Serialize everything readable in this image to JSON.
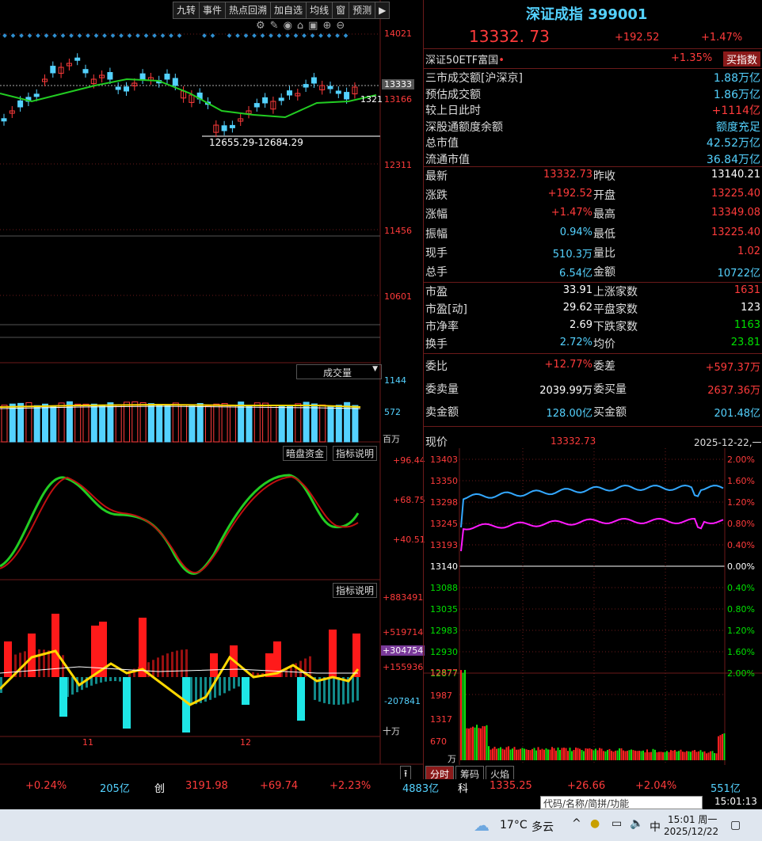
{
  "toolbar": {
    "items": [
      "九转",
      "事件",
      "热点回溯",
      "加自选",
      "均线",
      "窗",
      "预测"
    ]
  },
  "kline": {
    "yaxis": [
      "14021",
      "13333",
      "13166",
      "12311",
      "11456",
      "10601"
    ],
    "ma_value": "1321",
    "low_range": "12655.29-12684.29",
    "vol_label": "成交量",
    "vol_axis": [
      "1144",
      "572",
      "百万"
    ],
    "btn_dark": "暗盘资金",
    "btn_ind": "指标说明",
    "ind1_axis": [
      "+96.44",
      "+68.75",
      "+40.51"
    ],
    "btn_ind2": "指标说明",
    "ind2_axis": [
      "+883491",
      "+519714",
      "+304754",
      "+155936",
      "-207841",
      "十万"
    ],
    "dates": [
      "11",
      "12"
    ]
  },
  "quote": {
    "title": "深证成指 399001",
    "price": "13332. 73",
    "change": "+192.52",
    "pct": "+1.47%",
    "etf": {
      "label": "深证50ETF富国",
      "dot": "•",
      "pct": "+1.35%",
      "btn": "买指数"
    },
    "summary": [
      {
        "label": "三市成交额[沪深京]",
        "value": "1.88万亿",
        "color": "cyan"
      },
      {
        "label": "预估成交额",
        "value": "1.86万亿",
        "color": "cyan"
      },
      {
        "label": "较上日此时",
        "value": "+1114亿",
        "color": "red"
      },
      {
        "label": "深股通额度余额",
        "value": "额度充足",
        "color": "cyan"
      },
      {
        "label": "总市值",
        "value": "42.52万亿",
        "color": "cyan"
      },
      {
        "label": "流通市值",
        "value": "36.84万亿",
        "color": "cyan"
      }
    ],
    "grid1": [
      {
        "l1": "最新",
        "v1": "13332.73",
        "c1": "red",
        "l2": "昨收",
        "v2": "13140.21",
        "c2": "white"
      },
      {
        "l1": "涨跌",
        "v1": "+192.52",
        "c1": "red",
        "l2": "开盘",
        "v2": "13225.40",
        "c2": "red"
      },
      {
        "l1": "涨幅",
        "v1": "+1.47%",
        "c1": "red",
        "l2": "最高",
        "v2": "13349.08",
        "c2": "red"
      },
      {
        "l1": "振幅",
        "v1": "0.94%",
        "c1": "cyan",
        "l2": "最低",
        "v2": "13225.40",
        "c2": "red"
      },
      {
        "l1": "现手",
        "v1": "510.3万",
        "c1": "cyan",
        "l2": "量比",
        "v2": "1.02",
        "c2": "red"
      },
      {
        "l1": "总手",
        "v1": "6.54亿",
        "c1": "cyan",
        "l2": "金额",
        "v2": "10722亿",
        "c2": "cyan"
      }
    ],
    "grid2": [
      {
        "l1": "市盈",
        "v1": "33.91",
        "c1": "white",
        "l2": "上涨家数",
        "v2": "1631",
        "c2": "red"
      },
      {
        "l1": "市盈[动]",
        "v1": "29.62",
        "c1": "white",
        "l2": "平盘家数",
        "v2": "123",
        "c2": "white"
      },
      {
        "l1": "市净率",
        "v1": "2.69",
        "c1": "white",
        "l2": "下跌家数",
        "v2": "1163",
        "c2": "green"
      },
      {
        "l1": "换手",
        "v1": "2.72%",
        "c1": "cyan",
        "l2": "均价",
        "v2": "23.81",
        "c2": "green"
      }
    ],
    "grid3": [
      {
        "l1": "委比",
        "v1": "+12.77%",
        "c1": "red",
        "l2": "委差",
        "v2": "+597.37万",
        "c2": "red"
      },
      {
        "l1": "委卖量",
        "v1": "2039.99万",
        "c1": "white",
        "l2": "委买量",
        "v2": "2637.36万",
        "c2": "red"
      },
      {
        "l1": "卖金额",
        "v1": "128.00亿",
        "c1": "cyan",
        "l2": "买金额",
        "v2": "201.48亿",
        "c2": "cyan"
      }
    ]
  },
  "intraday": {
    "label": "现价",
    "price": "13332.73",
    "date": "2025-12-22,一",
    "left_axis": [
      "13403",
      "13350",
      "13298",
      "13245",
      "13193",
      "13140",
      "13088",
      "13035",
      "12983",
      "12930",
      "12877"
    ],
    "right_axis": [
      "2.00%",
      "1.60%",
      "1.20%",
      "0.80%",
      "0.40%",
      "0.00%",
      "0.40%",
      "0.80%",
      "1.20%",
      "1.60%",
      "2.00%"
    ],
    "vol_axis": [
      "12877",
      "1987",
      "1317",
      "670",
      "万"
    ],
    "tabs": [
      "分时",
      "筹码",
      "火焰"
    ]
  },
  "statusbar": {
    "items": [
      {
        "t": "+0.24%",
        "c": "red"
      },
      {
        "t": "205亿",
        "c": "cyan"
      },
      {
        "t": "创",
        "c": "white"
      },
      {
        "t": "3191.98",
        "c": "red"
      },
      {
        "t": "+69.74",
        "c": "red"
      },
      {
        "t": "+2.23%",
        "c": "red"
      },
      {
        "t": "4883亿",
        "c": "cyan"
      },
      {
        "t": "科",
        "c": "white"
      },
      {
        "t": "1335.25",
        "c": "red"
      },
      {
        "t": "+26.66",
        "c": "red"
      },
      {
        "t": "+2.04%",
        "c": "red"
      },
      {
        "t": "551亿",
        "c": "cyan"
      }
    ],
    "search_placeholder": "代码/名称/简拼/功能",
    "time": "15:01:13"
  },
  "taskbar": {
    "weather": "17°C",
    "cond": "多云",
    "ime": "中",
    "time": "15:01 周一",
    "date": "2025/12/22"
  },
  "chart_data": [
    {
      "type": "line",
      "title": "深证成指 分时",
      "ylim": [
        13140,
        13403
      ],
      "price_range": [
        "13140.21",
        "13349.08"
      ],
      "last": "13332.73",
      "series": [
        {
          "name": "现价"
        }
      ]
    }
  ]
}
